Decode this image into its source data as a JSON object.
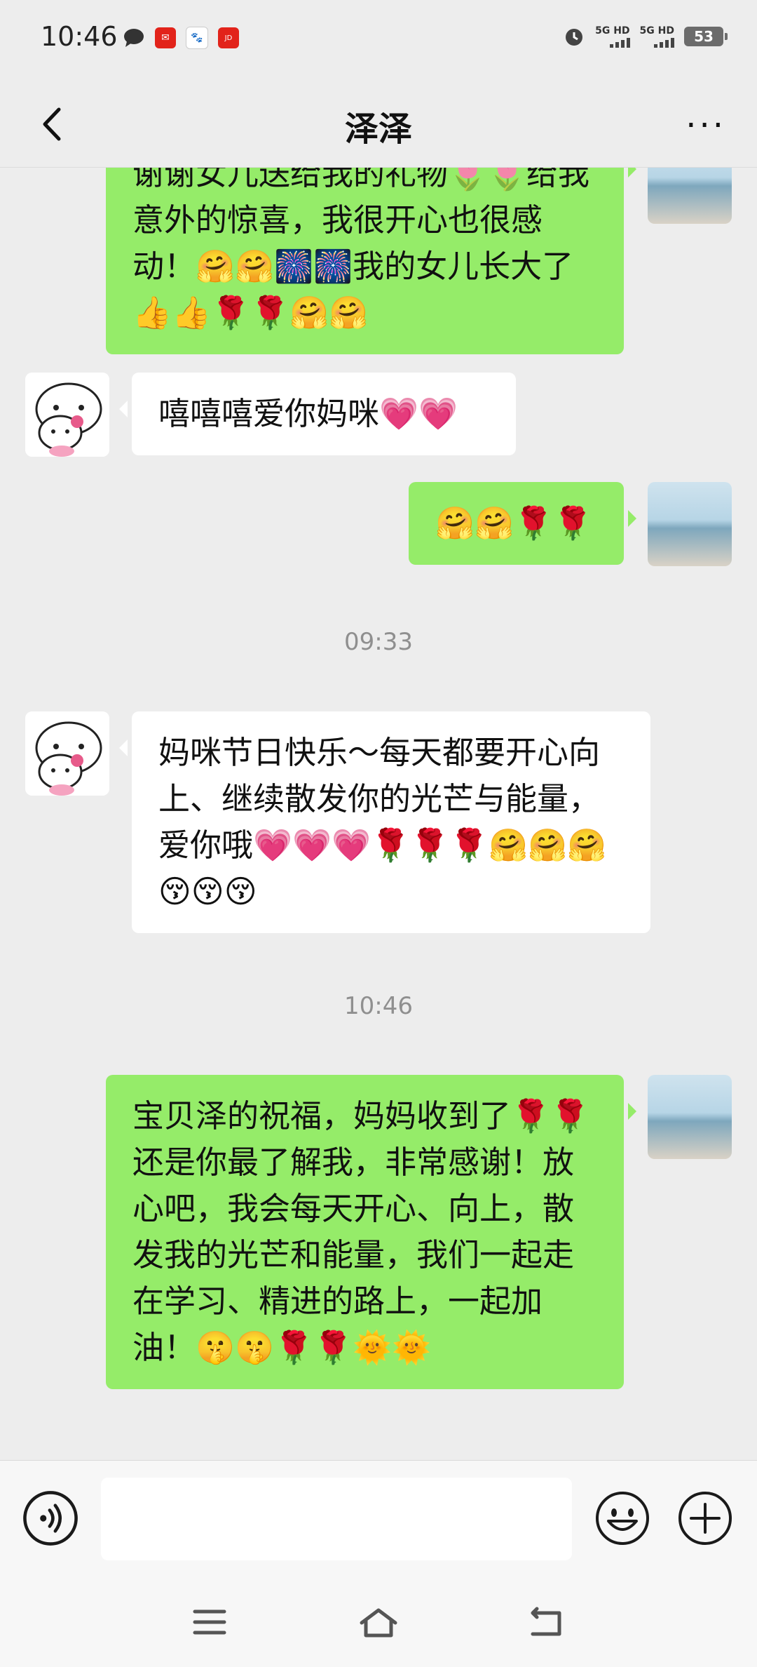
{
  "status_bar": {
    "time": "10:46",
    "signal_1": "5G HD",
    "signal_2": "5G HD",
    "battery": "53",
    "notification_icons": [
      "chat-bubble-icon",
      "app-red-icon",
      "baidu-paw-icon",
      "app-jd-icon"
    ]
  },
  "nav": {
    "title": "泽泽",
    "back_icon": "chevron-left-icon",
    "more_icon": "more-dots-icon"
  },
  "messages": [
    {
      "side": "me",
      "text": "谢谢女儿送给我的礼物🌷🌷给我意外的惊喜，我很开心也很感动！🤗🤗🎆🎆我的女儿长大了👍👍🌹🌹🤗🤗"
    },
    {
      "side": "them",
      "text": "嘻嘻嘻爱你妈咪💗💗"
    },
    {
      "side": "me",
      "text": "🤗🤗🌹🌹"
    },
    {
      "timestamp": "09:33"
    },
    {
      "side": "them",
      "text": "妈咪节日快乐～每天都要开心向上、继续散发你的光芒与能量，爱你哦💗💗💗🌹🌹🌹🤗🤗🤗😚😚😚"
    },
    {
      "timestamp": "10:46"
    },
    {
      "side": "me",
      "text": "宝贝泽的祝福，妈妈收到了🌹🌹还是你最了解我，非常感谢！放心吧，我会每天开心、向上，散发我的光芒和能量，我们一起走在学习、精进的路上，一起加油！🤫🤫🌹🌹🌞🌞"
    }
  ],
  "input_bar": {
    "placeholder": "",
    "voice_icon": "voice-icon",
    "emoji_icon": "emoji-icon",
    "plus_icon": "plus-icon"
  },
  "system_nav": {
    "menu_icon": "menu-icon",
    "home_icon": "home-icon",
    "back_icon": "back-icon"
  },
  "colors": {
    "my_bubble": "#95ec69",
    "their_bubble": "#ffffff",
    "background": "#ededed"
  }
}
